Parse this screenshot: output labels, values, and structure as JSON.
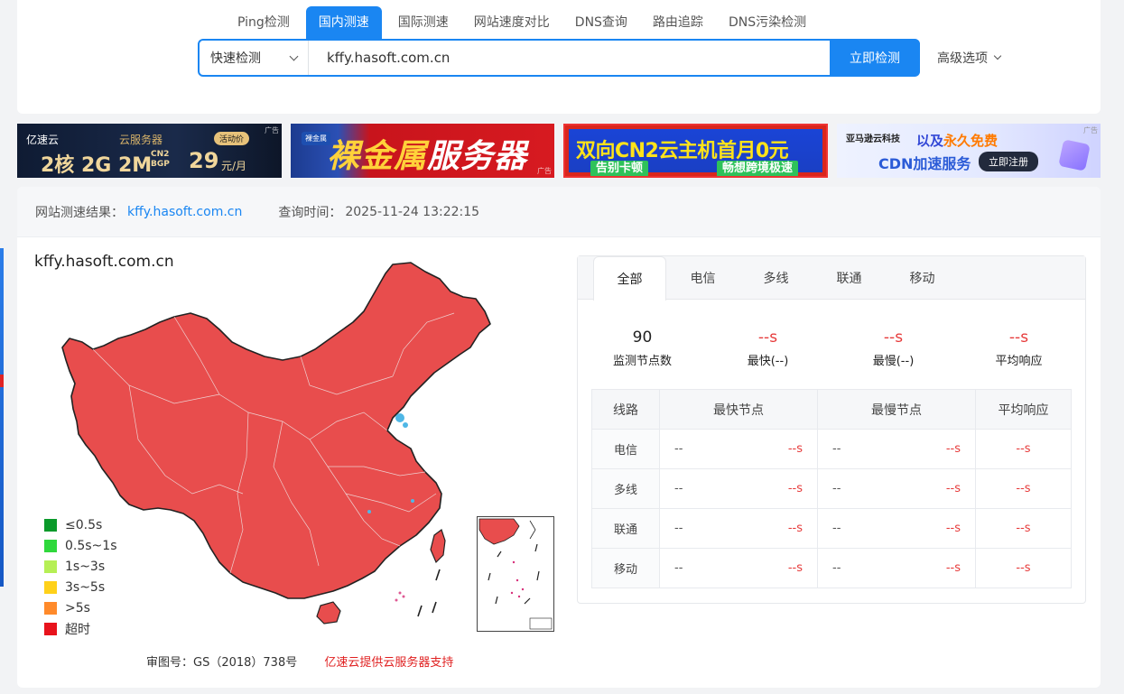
{
  "nav": {
    "tabs": [
      "Ping检测",
      "国内测速",
      "国际测速",
      "网站速度对比",
      "DNS查询",
      "路由追踪",
      "DNS污染检测"
    ],
    "active_index": 1
  },
  "search": {
    "mode": "快速检测",
    "value": "kffy.hasoft.com.cn",
    "submit_label": "立即检测",
    "advanced_label": "高级选项"
  },
  "ads": {
    "tag": "广告",
    "ad1": {
      "brand": "亿速云",
      "service": "云服务器",
      "promo": "活动价",
      "spec": "2核 2G 2M",
      "net1": "CN2",
      "net2": "BGP",
      "price": "29",
      "unit": "元/月"
    },
    "ad2": {
      "tag": "裸金属",
      "headline_a": "裸金属",
      "headline_b": "服务器"
    },
    "ad3": {
      "headline": "双向CN2云主机首月0元",
      "pill1": "告别卡顿",
      "pill2": "畅想跨境极速"
    },
    "ad4": {
      "brand": "亚马逊云科技",
      "headline_a": "以及",
      "headline_b": "永久免费",
      "line2": "CDN加速服务",
      "cta": "立即注册"
    }
  },
  "result": {
    "label": "网站测速结果：",
    "domain": "kffy.hasoft.com.cn",
    "time_label": "查询时间：",
    "time": "2025-11-24 13:22:15"
  },
  "map": {
    "title": "kffy.hasoft.com.cn",
    "fill_color": "#e84d4d",
    "legend": [
      {
        "label": "≤0.5s",
        "color": "#0a9a2a"
      },
      {
        "label": "0.5s~1s",
        "color": "#2fd83c"
      },
      {
        "label": "1s~3s",
        "color": "#b6ef55"
      },
      {
        "label": "3s~5s",
        "color": "#ffd11a"
      },
      {
        "label": ">5s",
        "color": "#ff8a2a"
      },
      {
        "label": "超时",
        "color": "#e8131c"
      }
    ],
    "approval": "审图号：GS（2018）738号",
    "support": "亿速云提供云服务器支持"
  },
  "panel": {
    "isp_tabs": [
      "全部",
      "电信",
      "多线",
      "联通",
      "移动"
    ],
    "active_isp": 0,
    "stats": [
      {
        "value": "90",
        "label": "监测节点数",
        "red": false
      },
      {
        "value": "--s",
        "label": "最快(--)",
        "red": true
      },
      {
        "value": "--s",
        "label": "最慢(--)",
        "red": true
      },
      {
        "value": "--s",
        "label": "平均响应",
        "red": true
      }
    ],
    "table_headers": [
      "线路",
      "最快节点",
      "最慢节点",
      "平均响应"
    ],
    "rows": [
      {
        "line": "电信",
        "fast_node": "--",
        "fast_time": "--s",
        "slow_node": "--",
        "slow_time": "--s",
        "avg": "--s"
      },
      {
        "line": "多线",
        "fast_node": "--",
        "fast_time": "--s",
        "slow_node": "--",
        "slow_time": "--s",
        "avg": "--s"
      },
      {
        "line": "联通",
        "fast_node": "--",
        "fast_time": "--s",
        "slow_node": "--",
        "slow_time": "--s",
        "avg": "--s"
      },
      {
        "line": "移动",
        "fast_node": "--",
        "fast_time": "--s",
        "slow_node": "--",
        "slow_time": "--s",
        "avg": "--s"
      }
    ]
  }
}
